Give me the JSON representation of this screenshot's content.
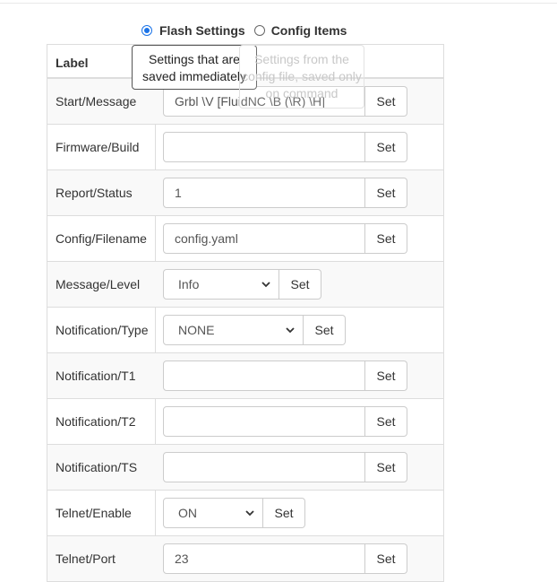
{
  "mode_selector": {
    "flash_label": "Flash Settings",
    "config_label": "Config Items",
    "selected": "flash"
  },
  "table": {
    "header_label": "Label"
  },
  "tooltips": {
    "flash": "Settings that are saved immediately",
    "config": "Settings from the config file, saved only on command"
  },
  "rows": [
    {
      "label": "Start/Message",
      "kind": "text",
      "value": "Grbl \\V [FluidNC \\B (\\R) \\H]",
      "button": "Set"
    },
    {
      "label": "Firmware/Build",
      "kind": "text",
      "value": "",
      "button": "Set"
    },
    {
      "label": "Report/Status",
      "kind": "text",
      "value": "1",
      "button": "Set"
    },
    {
      "label": "Config/Filename",
      "kind": "text",
      "value": "config.yaml",
      "button": "Set"
    },
    {
      "label": "Message/Level",
      "kind": "select",
      "value": "Info",
      "button": "Set"
    },
    {
      "label": "Notification/Type",
      "kind": "select",
      "value": "NONE",
      "button": "Set"
    },
    {
      "label": "Notification/T1",
      "kind": "text",
      "value": "",
      "button": "Set"
    },
    {
      "label": "Notification/T2",
      "kind": "text",
      "value": "",
      "button": "Set"
    },
    {
      "label": "Notification/TS",
      "kind": "text",
      "value": "",
      "button": "Set"
    },
    {
      "label": "Telnet/Enable",
      "kind": "select",
      "value": "ON",
      "button": "Set"
    },
    {
      "label": "Telnet/Port",
      "kind": "text",
      "value": "23",
      "button": "Set"
    }
  ]
}
